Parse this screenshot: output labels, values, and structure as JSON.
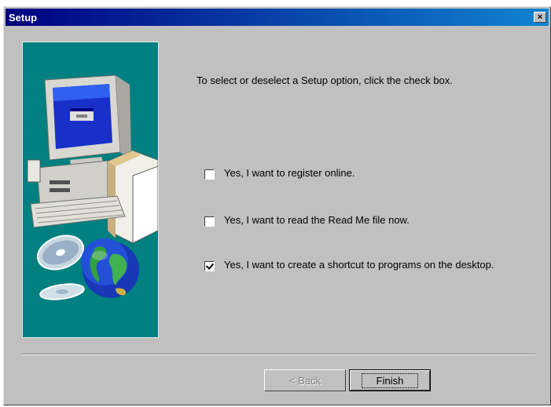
{
  "window": {
    "title": "Setup",
    "close_glyph": "×"
  },
  "instruction": "To select or deselect a Setup option, click the check box.",
  "options": [
    {
      "label": "Yes, I want to register online.",
      "checked": false
    },
    {
      "label": "Yes, I want to read the Read Me file now.",
      "checked": false
    },
    {
      "label": "Yes, I want to create a shortcut to programs on the desktop.",
      "checked": true
    }
  ],
  "buttons": {
    "back": {
      "label": "< Back",
      "disabled": true
    },
    "finish": {
      "label": "Finish",
      "default": true
    }
  },
  "illustration": {
    "background": "#008080",
    "icons": [
      "computer-icon",
      "cd-icon",
      "globe-icon"
    ]
  }
}
